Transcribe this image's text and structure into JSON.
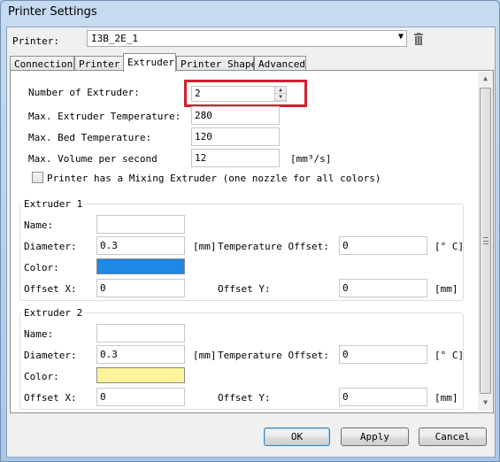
{
  "window": {
    "title": "Printer Settings"
  },
  "printer": {
    "label": "Printer:",
    "selected": "I3B_2E_1",
    "delete_icon": "trash-icon"
  },
  "tabs": [
    {
      "label": "Connection",
      "active": false
    },
    {
      "label": "Printer",
      "active": false
    },
    {
      "label": "Extruder",
      "active": true
    },
    {
      "label": "Printer Shape",
      "active": false
    },
    {
      "label": "Advanced",
      "active": false
    }
  ],
  "extruder": {
    "num_label": "Number of Extruder:",
    "num_value": "2",
    "max_temp_label": "Max. Extruder Temperature:",
    "max_temp_value": "280",
    "bed_temp_label": "Max. Bed Temperature:",
    "bed_temp_value": "120",
    "volume_label": "Max. Volume per second",
    "volume_value": "12",
    "volume_unit": "[mm³/s]",
    "mixing_label": "Printer has a Mixing Extruder (one nozzle for all colors)",
    "mixing_checked": false,
    "highlight_color": "#d02030"
  },
  "extruders": [
    {
      "title": "Extruder 1",
      "name_label": "Name:",
      "name_value": "",
      "diameter_label": "Diameter:",
      "diameter_value": "0.3",
      "diameter_unit": "[mm]",
      "temp_offset_label": "Temperature Offset:",
      "temp_offset_value": "0",
      "temp_offset_unit": "[° C]",
      "color_label": "Color:",
      "color": "#1e88e5",
      "offset_x_label": "Offset X:",
      "offset_x_value": "0",
      "offset_y_label": "Offset Y:",
      "offset_y_value": "0",
      "offset_unit": "[mm]"
    },
    {
      "title": "Extruder 2",
      "name_label": "Name:",
      "name_value": "",
      "diameter_label": "Diameter:",
      "diameter_value": "0.3",
      "diameter_unit": "[mm]",
      "temp_offset_label": "Temperature Offset:",
      "temp_offset_value": "0",
      "temp_offset_unit": "[° C]",
      "color_label": "Color:",
      "color": "#fdf39a",
      "offset_x_label": "Offset X:",
      "offset_x_value": "0",
      "offset_y_label": "Offset Y:",
      "offset_y_value": "0",
      "offset_unit": "[mm]"
    }
  ],
  "buttons": {
    "ok": "OK",
    "apply": "Apply",
    "cancel": "Cancel"
  }
}
